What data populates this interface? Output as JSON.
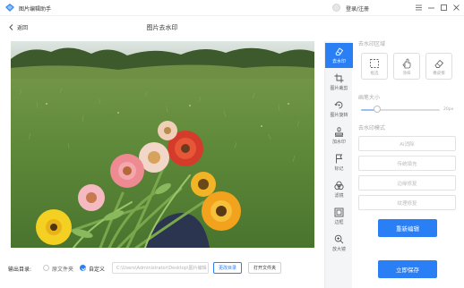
{
  "app": {
    "title": "图片编辑助手"
  },
  "user": {
    "login_label": "登录/注册"
  },
  "header": {
    "back_label": "返回",
    "page_title": "图片去水印"
  },
  "tools": [
    {
      "label": "去水印",
      "icon": "eraser-icon",
      "active": true
    },
    {
      "label": "图片裁剪",
      "icon": "crop-icon",
      "active": false
    },
    {
      "label": "图片旋转",
      "icon": "rotate-icon",
      "active": false
    },
    {
      "label": "加水印",
      "icon": "stamp-icon",
      "active": false
    },
    {
      "label": "标记",
      "icon": "flag-icon",
      "active": false
    },
    {
      "label": "滤镜",
      "icon": "filter-icon",
      "active": false
    },
    {
      "label": "边框",
      "icon": "frame-icon",
      "active": false
    },
    {
      "label": "放大镜",
      "icon": "magnifier-icon",
      "active": false
    }
  ],
  "panel": {
    "area_title": "去水印区域",
    "modes": [
      {
        "label": "框选",
        "icon": "marquee-icon"
      },
      {
        "label": "涂抹",
        "icon": "hand-icon"
      },
      {
        "label": "橡皮擦",
        "icon": "eraser-small-icon"
      }
    ],
    "brush_title": "画笔大小",
    "brush_value": "20px",
    "brush_level": 0.2,
    "mode_title": "去水印模式",
    "options": [
      "AI消除",
      "传统填充",
      "边缘修复",
      "纹理修复"
    ],
    "reedit_label": "重新编辑",
    "save_label": "立即保存"
  },
  "output": {
    "label": "输出目录:",
    "original_label": "原文件夹",
    "custom_label": "自定义",
    "custom_selected": true,
    "path": "C:\\Users\\Administrator\\Desktop\\图片编辑",
    "change_dir_label": "更改目录",
    "open_folder_label": "打开文件夹"
  },
  "colors": {
    "accent": "#2a7ff5",
    "rail_bg": "#f4f5f7"
  }
}
